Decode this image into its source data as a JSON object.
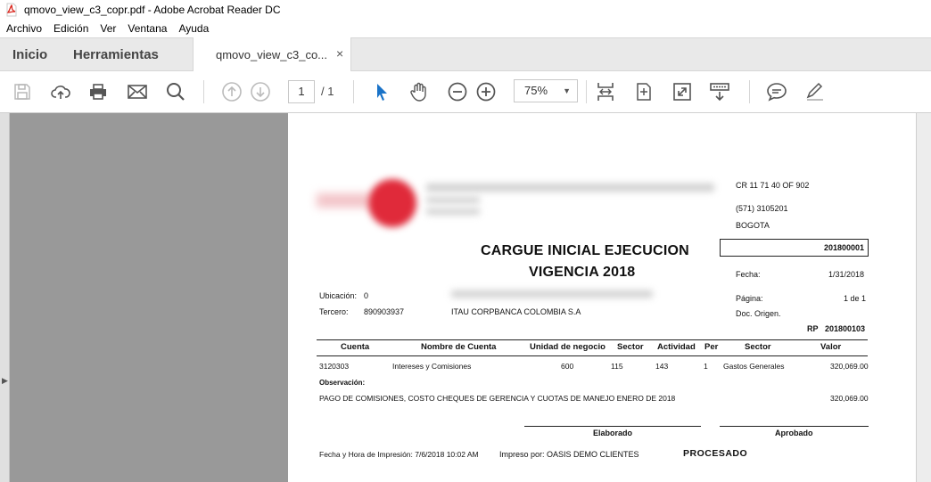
{
  "window": {
    "title": "qmovo_view_c3_copr.pdf - Adobe Acrobat Reader DC"
  },
  "menu": [
    "Archivo",
    "Edición",
    "Ver",
    "Ventana",
    "Ayuda"
  ],
  "tabs": {
    "home": "Inicio",
    "tools": "Herramientas",
    "document": "qmovo_view_c3_co...",
    "close": "×"
  },
  "toolbar": {
    "page_current": "1",
    "page_total": "/ 1",
    "zoom": "75%"
  },
  "icons": [
    "save-icon",
    "upload-icon",
    "print-icon",
    "email-icon",
    "search-icon",
    "page-up-icon",
    "page-down-icon",
    "select-pointer-icon",
    "hand-icon",
    "zoom-out-icon",
    "zoom-in-icon",
    "fit-page-icon",
    "rotate-icon",
    "fullscreen-icon",
    "read-mode-icon",
    "comment-icon",
    "sign-icon"
  ],
  "document": {
    "address": "CR 11 71 40 OF 902",
    "phone": "(571) 3105201",
    "city": "BOGOTA",
    "title1": "CARGUE INICIAL EJECUCION",
    "title2": "VIGENCIA  2018",
    "doc_number": "201800001",
    "fecha_label": "Fecha:",
    "fecha_value": "1/31/2018",
    "pagina_label": "Página:",
    "pagina_value": "1 de 1",
    "doc_origen_label": "Doc. Origen.",
    "rp_label": "RP",
    "rp_value": "201800103",
    "ubicacion_label": "Ubicación:",
    "ubicacion_value": "0",
    "tercero_label": "Tercero:",
    "tercero_nit": "890903937",
    "tercero_name": "ITAU CORPBANCA COLOMBIA S.A",
    "table_headers": [
      "Cuenta",
      "Nombre de Cuenta",
      "Unidad de negocio",
      "Sector",
      "Actividad",
      "Per",
      "Sector",
      "Valor"
    ],
    "row": {
      "cuenta": "3120303",
      "nombre": "Intereses y Comisiones",
      "unidad": "600",
      "sector": "115",
      "actividad": "143",
      "per": "1",
      "sector2": "Gastos Generales",
      "valor": "320,069.00"
    },
    "observacion_label": "Observación:",
    "observacion_text": "PAGO DE COMISIONES, COSTO CHEQUES DE GERENCIA Y CUOTAS DE MANEJO ENERO DE 2018",
    "observacion_valor": "320,069.00",
    "elaborado": "Elaborado",
    "aprobado": "Aprobado",
    "impresion": "Fecha y Hora de Impresión: 7/6/2018 10:02 AM",
    "impreso_por": "Impreso por: OASIS DEMO CLIENTES",
    "estado": "PROCESADO"
  },
  "colors": {
    "accent_blue": "#1a73c8",
    "pdf_red": "#d9251c",
    "viewer_bg": "#999999"
  }
}
